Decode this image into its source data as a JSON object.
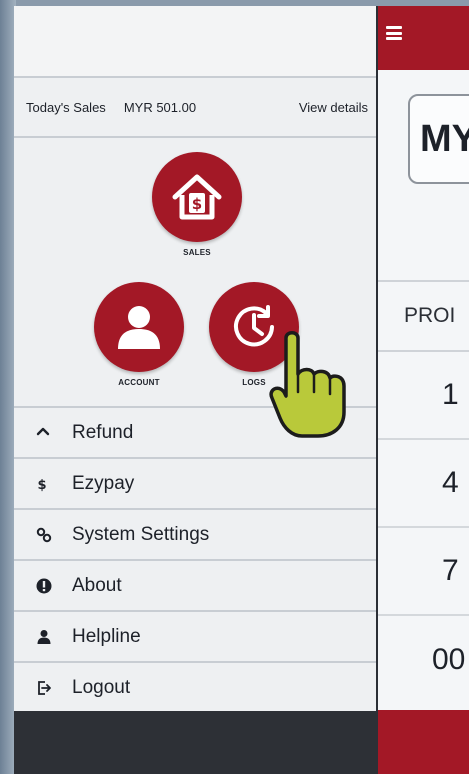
{
  "drawer": {
    "sales_summary": {
      "label": "Today's Sales",
      "amount": "MYR 501.00",
      "link": "View details"
    },
    "shortcuts": [
      {
        "label": "SALES",
        "icon": "house-dollar-icon"
      },
      {
        "label": "ACCOUNT",
        "icon": "user-icon"
      },
      {
        "label": "LOGS",
        "icon": "clock-history-icon"
      }
    ],
    "menu": [
      {
        "label": "Refund",
        "icon": "undo-arrow-icon"
      },
      {
        "label": "Ezypay",
        "icon": "dollar-icon"
      },
      {
        "label": "System Settings",
        "icon": "gears-icon"
      },
      {
        "label": "About",
        "icon": "info-icon"
      },
      {
        "label": "Helpline",
        "icon": "user-icon"
      },
      {
        "label": "Logout",
        "icon": "logout-icon"
      }
    ]
  },
  "main": {
    "currency_partial": "MY",
    "column_header_partial": "PROI",
    "rows_partial": [
      "1",
      "4",
      "7",
      "00"
    ]
  },
  "colors": {
    "accent": "#a31826",
    "dark": "#2d3036",
    "drawer_bg": "#eef0f2"
  }
}
